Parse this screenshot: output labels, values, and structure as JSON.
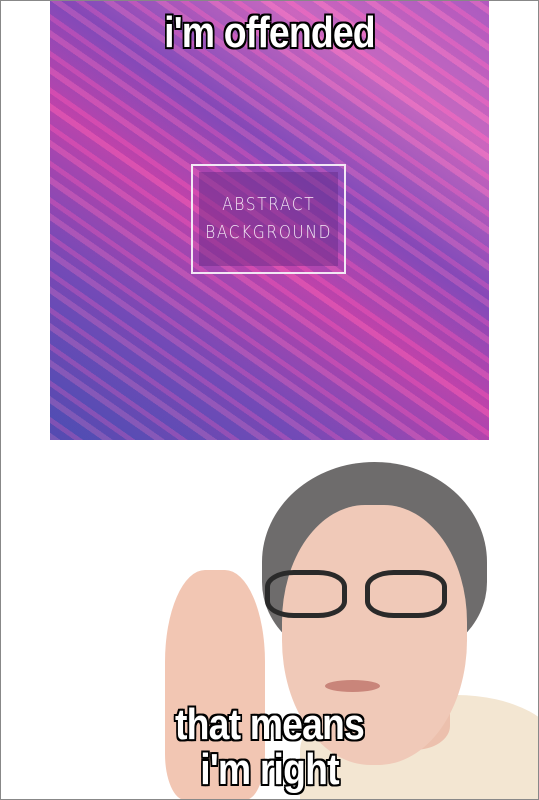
{
  "meme": {
    "top_caption": "i'm offended",
    "bottom_caption_line1": "that means",
    "bottom_caption_line2": "i'm right"
  },
  "abstract_image": {
    "line1": "ABSTRACT",
    "line2": "BACKGROUND",
    "colors": {
      "pink": "#d044a8",
      "purple": "#7b4bb5",
      "blue": "#4a4fb0"
    }
  }
}
